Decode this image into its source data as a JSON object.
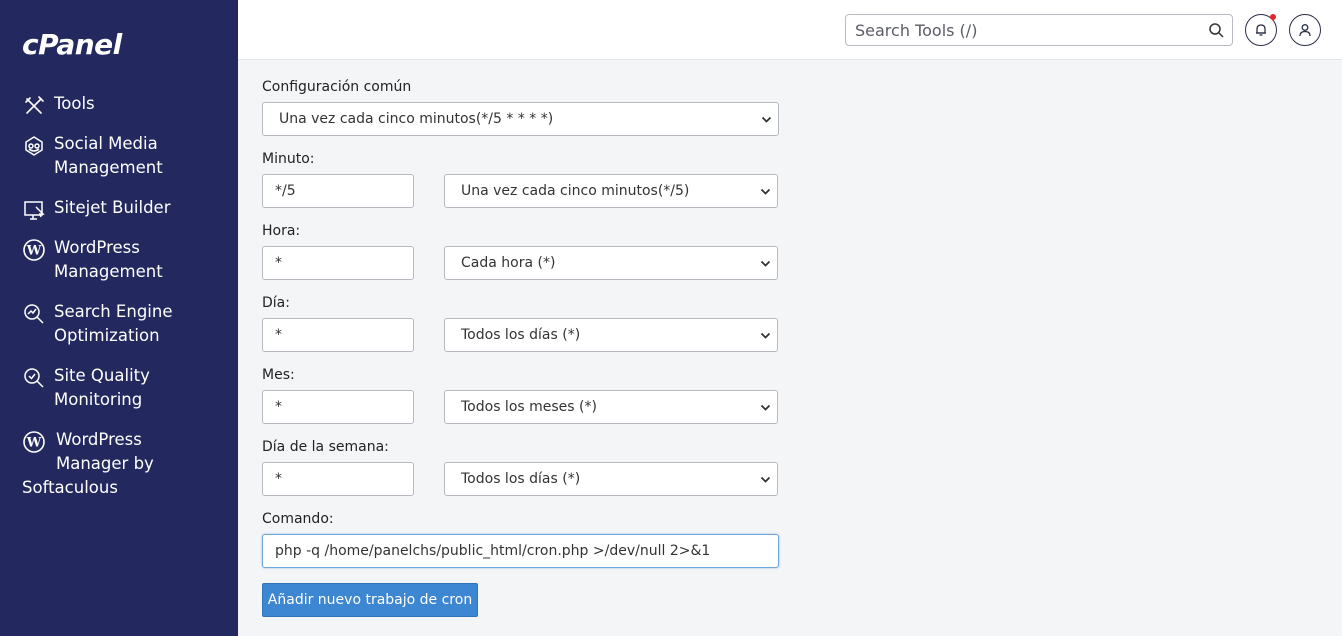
{
  "brand": {
    "logo_text": "cPanel"
  },
  "sidebar": {
    "items": [
      {
        "label": "Tools",
        "icon": "tools-icon"
      },
      {
        "label_line1": "Social Media",
        "label_line2": "Management",
        "icon": "social-media-icon"
      },
      {
        "label": "Sitejet Builder",
        "icon": "sitejet-icon"
      },
      {
        "label_line1": "WordPress",
        "label_line2": "Management",
        "icon": "wordpress-icon"
      },
      {
        "label_line1": "Search Engine",
        "label_line2": "Optimization",
        "icon": "seo-icon"
      },
      {
        "label_line1": "Site Quality",
        "label_line2": "Monitoring",
        "icon": "site-quality-icon"
      },
      {
        "label_line1": "WordPress",
        "label_line2": "Manager by",
        "label_line3": "Softaculous",
        "icon": "wordpress-icon"
      }
    ]
  },
  "header": {
    "search_placeholder": "Search Tools (/)",
    "notification_color": "#e0282a"
  },
  "form": {
    "common": {
      "label": "Configuración común",
      "value": "Una vez cada cinco minutos(*/5 * * * *)"
    },
    "minute": {
      "label": "Minuto:",
      "value": "*/5",
      "option": "Una vez cada cinco minutos(*/5)"
    },
    "hour": {
      "label": "Hora:",
      "value": "*",
      "option": "Cada hora (*)"
    },
    "day": {
      "label": "Día:",
      "value": "*",
      "option": "Todos los días (*)"
    },
    "month": {
      "label": "Mes:",
      "value": "*",
      "option": "Todos los meses (*)"
    },
    "weekday": {
      "label": "Día de la semana:",
      "value": "*",
      "option": "Todos los días (*)"
    },
    "command": {
      "label": "Comando:",
      "value": "php -q /home/panelchs/public_html/cron.php >/dev/null 2>&1"
    },
    "submit_label": "Añadir nuevo trabajo de cron"
  },
  "colors": {
    "sidebar_bg": "#23295e",
    "button_bg": "#3d86d1"
  }
}
